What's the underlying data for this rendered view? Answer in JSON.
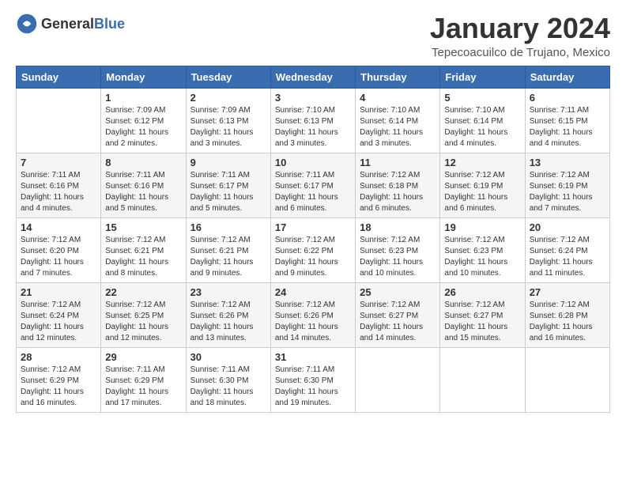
{
  "logo": {
    "general": "General",
    "blue": "Blue"
  },
  "title": "January 2024",
  "location": "Tepecoacuilco de Trujano, Mexico",
  "days_header": [
    "Sunday",
    "Monday",
    "Tuesday",
    "Wednesday",
    "Thursday",
    "Friday",
    "Saturday"
  ],
  "weeks": [
    [
      {
        "day": "",
        "sunrise": "",
        "sunset": "",
        "daylight": ""
      },
      {
        "day": "1",
        "sunrise": "Sunrise: 7:09 AM",
        "sunset": "Sunset: 6:12 PM",
        "daylight": "Daylight: 11 hours and 2 minutes."
      },
      {
        "day": "2",
        "sunrise": "Sunrise: 7:09 AM",
        "sunset": "Sunset: 6:13 PM",
        "daylight": "Daylight: 11 hours and 3 minutes."
      },
      {
        "day": "3",
        "sunrise": "Sunrise: 7:10 AM",
        "sunset": "Sunset: 6:13 PM",
        "daylight": "Daylight: 11 hours and 3 minutes."
      },
      {
        "day": "4",
        "sunrise": "Sunrise: 7:10 AM",
        "sunset": "Sunset: 6:14 PM",
        "daylight": "Daylight: 11 hours and 3 minutes."
      },
      {
        "day": "5",
        "sunrise": "Sunrise: 7:10 AM",
        "sunset": "Sunset: 6:14 PM",
        "daylight": "Daylight: 11 hours and 4 minutes."
      },
      {
        "day": "6",
        "sunrise": "Sunrise: 7:11 AM",
        "sunset": "Sunset: 6:15 PM",
        "daylight": "Daylight: 11 hours and 4 minutes."
      }
    ],
    [
      {
        "day": "7",
        "sunrise": "Sunrise: 7:11 AM",
        "sunset": "Sunset: 6:16 PM",
        "daylight": "Daylight: 11 hours and 4 minutes."
      },
      {
        "day": "8",
        "sunrise": "Sunrise: 7:11 AM",
        "sunset": "Sunset: 6:16 PM",
        "daylight": "Daylight: 11 hours and 5 minutes."
      },
      {
        "day": "9",
        "sunrise": "Sunrise: 7:11 AM",
        "sunset": "Sunset: 6:17 PM",
        "daylight": "Daylight: 11 hours and 5 minutes."
      },
      {
        "day": "10",
        "sunrise": "Sunrise: 7:11 AM",
        "sunset": "Sunset: 6:17 PM",
        "daylight": "Daylight: 11 hours and 6 minutes."
      },
      {
        "day": "11",
        "sunrise": "Sunrise: 7:12 AM",
        "sunset": "Sunset: 6:18 PM",
        "daylight": "Daylight: 11 hours and 6 minutes."
      },
      {
        "day": "12",
        "sunrise": "Sunrise: 7:12 AM",
        "sunset": "Sunset: 6:19 PM",
        "daylight": "Daylight: 11 hours and 6 minutes."
      },
      {
        "day": "13",
        "sunrise": "Sunrise: 7:12 AM",
        "sunset": "Sunset: 6:19 PM",
        "daylight": "Daylight: 11 hours and 7 minutes."
      }
    ],
    [
      {
        "day": "14",
        "sunrise": "Sunrise: 7:12 AM",
        "sunset": "Sunset: 6:20 PM",
        "daylight": "Daylight: 11 hours and 7 minutes."
      },
      {
        "day": "15",
        "sunrise": "Sunrise: 7:12 AM",
        "sunset": "Sunset: 6:21 PM",
        "daylight": "Daylight: 11 hours and 8 minutes."
      },
      {
        "day": "16",
        "sunrise": "Sunrise: 7:12 AM",
        "sunset": "Sunset: 6:21 PM",
        "daylight": "Daylight: 11 hours and 9 minutes."
      },
      {
        "day": "17",
        "sunrise": "Sunrise: 7:12 AM",
        "sunset": "Sunset: 6:22 PM",
        "daylight": "Daylight: 11 hours and 9 minutes."
      },
      {
        "day": "18",
        "sunrise": "Sunrise: 7:12 AM",
        "sunset": "Sunset: 6:23 PM",
        "daylight": "Daylight: 11 hours and 10 minutes."
      },
      {
        "day": "19",
        "sunrise": "Sunrise: 7:12 AM",
        "sunset": "Sunset: 6:23 PM",
        "daylight": "Daylight: 11 hours and 10 minutes."
      },
      {
        "day": "20",
        "sunrise": "Sunrise: 7:12 AM",
        "sunset": "Sunset: 6:24 PM",
        "daylight": "Daylight: 11 hours and 11 minutes."
      }
    ],
    [
      {
        "day": "21",
        "sunrise": "Sunrise: 7:12 AM",
        "sunset": "Sunset: 6:24 PM",
        "daylight": "Daylight: 11 hours and 12 minutes."
      },
      {
        "day": "22",
        "sunrise": "Sunrise: 7:12 AM",
        "sunset": "Sunset: 6:25 PM",
        "daylight": "Daylight: 11 hours and 12 minutes."
      },
      {
        "day": "23",
        "sunrise": "Sunrise: 7:12 AM",
        "sunset": "Sunset: 6:26 PM",
        "daylight": "Daylight: 11 hours and 13 minutes."
      },
      {
        "day": "24",
        "sunrise": "Sunrise: 7:12 AM",
        "sunset": "Sunset: 6:26 PM",
        "daylight": "Daylight: 11 hours and 14 minutes."
      },
      {
        "day": "25",
        "sunrise": "Sunrise: 7:12 AM",
        "sunset": "Sunset: 6:27 PM",
        "daylight": "Daylight: 11 hours and 14 minutes."
      },
      {
        "day": "26",
        "sunrise": "Sunrise: 7:12 AM",
        "sunset": "Sunset: 6:27 PM",
        "daylight": "Daylight: 11 hours and 15 minutes."
      },
      {
        "day": "27",
        "sunrise": "Sunrise: 7:12 AM",
        "sunset": "Sunset: 6:28 PM",
        "daylight": "Daylight: 11 hours and 16 minutes."
      }
    ],
    [
      {
        "day": "28",
        "sunrise": "Sunrise: 7:12 AM",
        "sunset": "Sunset: 6:29 PM",
        "daylight": "Daylight: 11 hours and 16 minutes."
      },
      {
        "day": "29",
        "sunrise": "Sunrise: 7:11 AM",
        "sunset": "Sunset: 6:29 PM",
        "daylight": "Daylight: 11 hours and 17 minutes."
      },
      {
        "day": "30",
        "sunrise": "Sunrise: 7:11 AM",
        "sunset": "Sunset: 6:30 PM",
        "daylight": "Daylight: 11 hours and 18 minutes."
      },
      {
        "day": "31",
        "sunrise": "Sunrise: 7:11 AM",
        "sunset": "Sunset: 6:30 PM",
        "daylight": "Daylight: 11 hours and 19 minutes."
      },
      {
        "day": "",
        "sunrise": "",
        "sunset": "",
        "daylight": ""
      },
      {
        "day": "",
        "sunrise": "",
        "sunset": "",
        "daylight": ""
      },
      {
        "day": "",
        "sunrise": "",
        "sunset": "",
        "daylight": ""
      }
    ]
  ]
}
